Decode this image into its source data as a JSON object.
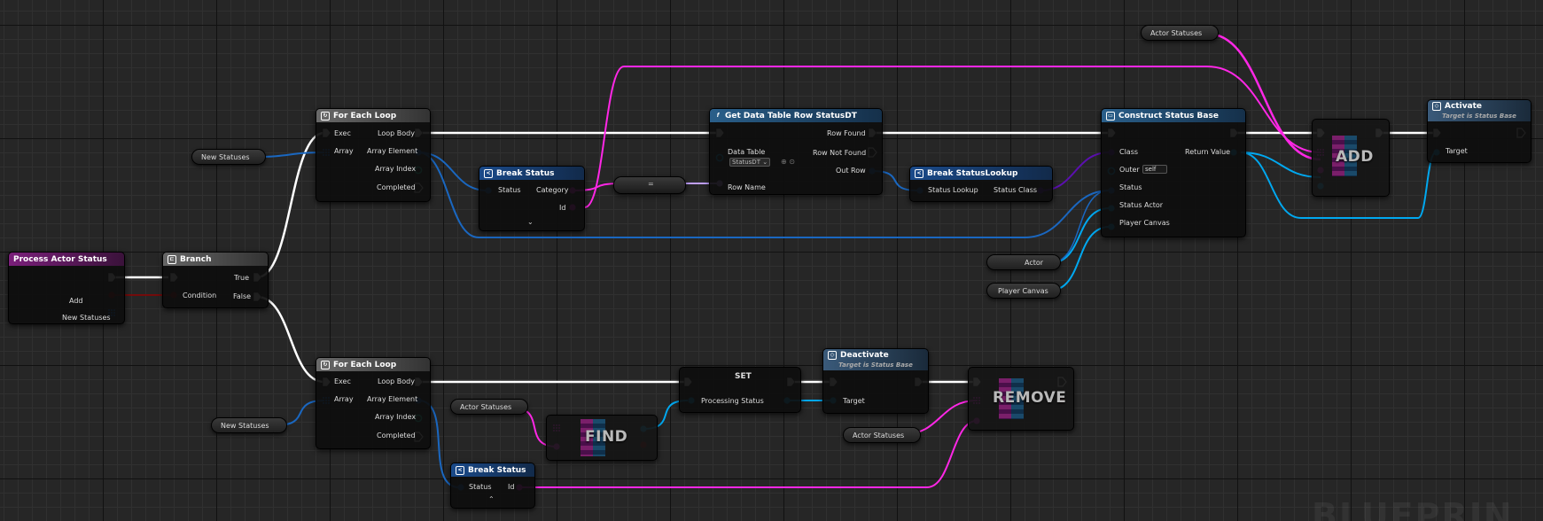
{
  "colors": {
    "exec": "#ffffff",
    "bool": "#8b0000",
    "struct": "#1a67c0",
    "name": "#ff27e6",
    "int": "#1fe0b0",
    "obj": "#00a8f0",
    "class": "#5b0fb0",
    "byte": "#c0a0ff"
  },
  "event": {
    "title": "Process Actor Status",
    "add": "Add",
    "statuses": "New Statuses"
  },
  "branch": {
    "title": "Branch",
    "condition": "Condition",
    "true_label": "True",
    "false_label": "False"
  },
  "loop1": {
    "title": "For Each Loop",
    "exec": "Exec",
    "array": "Array",
    "loop_body": "Loop Body",
    "array_element": "Array Element",
    "array_index": "Array Index",
    "completed": "Completed"
  },
  "loop2": {
    "title": "For Each Loop",
    "exec": "Exec",
    "array": "Array",
    "loop_body": "Loop Body",
    "array_element": "Array Element",
    "array_index": "Array Index",
    "completed": "Completed"
  },
  "vars": {
    "new_statuses_1": "New Statuses",
    "new_statuses_2": "New Statuses",
    "actor_statuses_top": "Actor Statuses",
    "actor_statuses_find": "Actor Statuses",
    "actor_statuses_remove": "Actor Statuses",
    "actor": "Actor",
    "player_canvas": "Player Canvas"
  },
  "break1": {
    "title": "Break Status",
    "status": "Status",
    "category": "Category",
    "id": "Id"
  },
  "break2": {
    "title": "Break Status",
    "status": "Status",
    "id": "Id"
  },
  "convert": {
    "label": "="
  },
  "datatable": {
    "title": "Get Data Table Row StatusDT",
    "data_table": "Data Table",
    "data_table_value": "StatusDT",
    "row_name": "Row Name",
    "row_found": "Row Found",
    "row_not_found": "Row Not Found",
    "out_row": "Out Row"
  },
  "breaklookup": {
    "title": "Break StatusLookup",
    "status_lookup": "Status Lookup",
    "status_class": "Status Class"
  },
  "construct": {
    "title": "Construct Status Base",
    "class": "Class",
    "outer": "Outer",
    "outer_value": "self",
    "status": "Status",
    "status_actor": "Status Actor",
    "player_canvas": "Player Canvas",
    "return_value": "Return Value"
  },
  "add": {
    "label": "ADD"
  },
  "activate": {
    "title": "Activate",
    "subtitle": "Target is Status Base",
    "target": "Target"
  },
  "set": {
    "title": "SET",
    "processing_status": "Processing Status"
  },
  "deactivate": {
    "title": "Deactivate",
    "subtitle": "Target is Status Base",
    "target": "Target"
  },
  "find": {
    "label": "FIND"
  },
  "remove": {
    "label": "REMOVE"
  },
  "watermark": "BLUEPRIN"
}
